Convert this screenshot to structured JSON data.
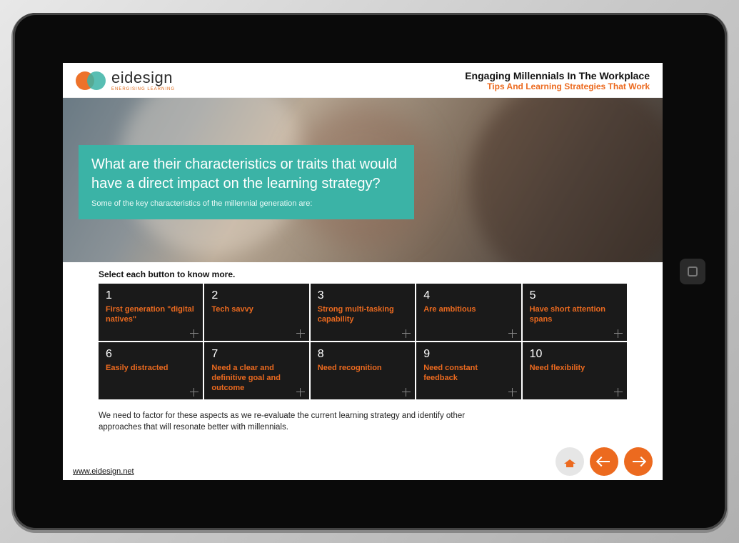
{
  "logo": {
    "name": "eidesign",
    "tagline": "ENERGISING LEARNING"
  },
  "header": {
    "title": "Engaging Millennials In The Workplace",
    "subtitle": "Tips And Learning Strategies That Work"
  },
  "hero": {
    "question": "What are their characteristics or traits that would have a direct impact on the learning strategy?",
    "subtitle": "Some of the key characteristics of the millennial generation are:"
  },
  "instruction": "Select each button to know more.",
  "tiles": [
    {
      "num": "1",
      "label": "First generation \"digital natives\""
    },
    {
      "num": "2",
      "label": "Tech savvy"
    },
    {
      "num": "3",
      "label": "Strong multi-tasking capability"
    },
    {
      "num": "4",
      "label": "Are ambitious"
    },
    {
      "num": "5",
      "label": "Have short attention spans"
    },
    {
      "num": "6",
      "label": "Easily distracted"
    },
    {
      "num": "7",
      "label": "Need a clear and definitive goal and outcome"
    },
    {
      "num": "8",
      "label": "Need recognition"
    },
    {
      "num": "9",
      "label": "Need constant feedback"
    },
    {
      "num": "10",
      "label": "Need flexibility"
    }
  ],
  "summary": "We need to factor for these aspects as we re-evaluate the current learning strategy and identify other approaches that will resonate better with millennials.",
  "footer": {
    "url": "www.eidesign.net"
  }
}
